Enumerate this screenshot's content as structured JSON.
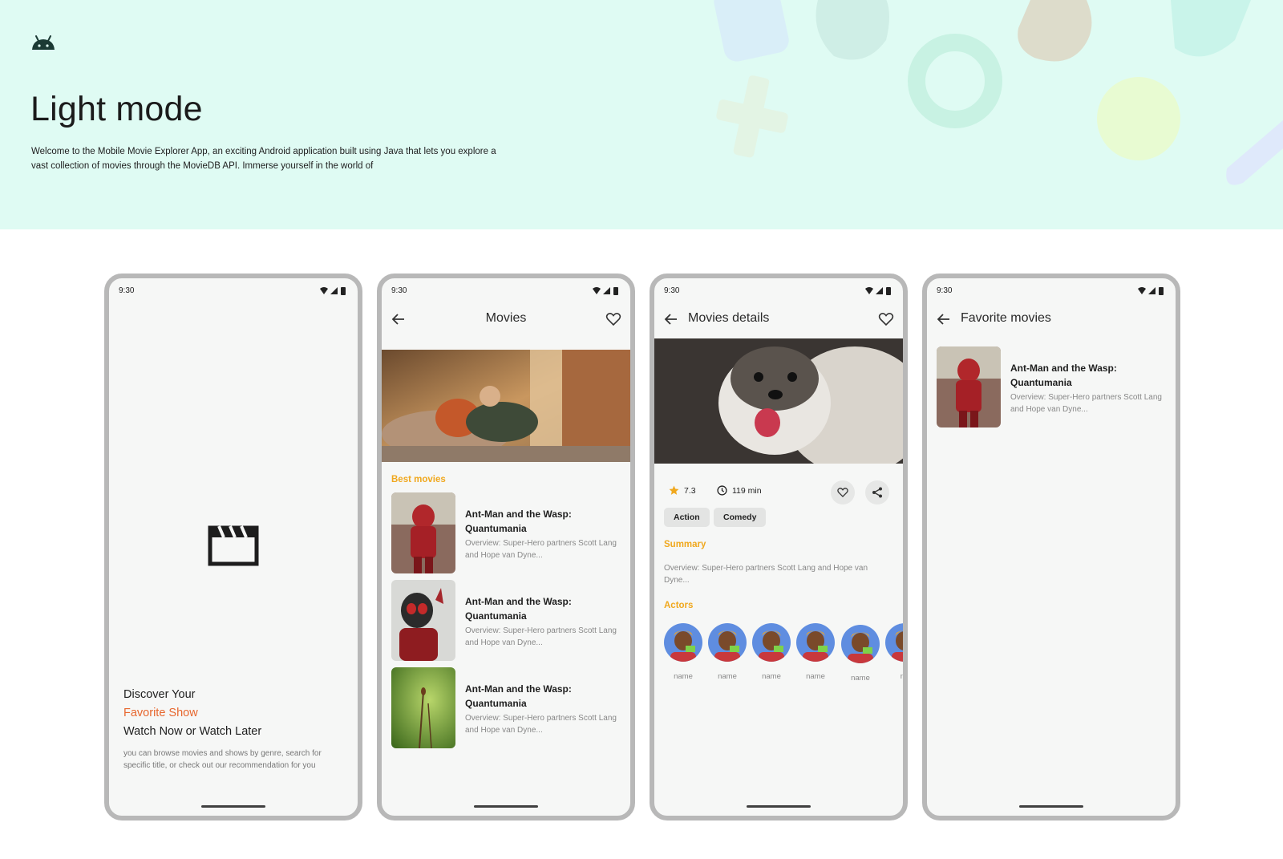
{
  "hero": {
    "title": "Light mode",
    "description": "Welcome to the Mobile Movie Explorer App, an exciting Android application built using Java that lets you explore a vast collection of movies through the MovieDB API. Immerse yourself in the world of"
  },
  "status": {
    "time": "9:30"
  },
  "splash": {
    "line1": "Discover Your",
    "line2": "Favorite Show",
    "line3": "Watch Now or Watch Later",
    "subtitle": "you can browse movies and shows by genre, search for specific title, or check out our recommendation for you"
  },
  "movies_screen": {
    "title": "Movies",
    "section": "Best movies",
    "items": [
      {
        "title": "Ant-Man and the Wasp: Quantumania",
        "overview": "Overview: Super-Hero partners Scott Lang and Hope van Dyne..."
      },
      {
        "title": "Ant-Man and the Wasp: Quantumania",
        "overview": "Overview: Super-Hero partners Scott Lang and Hope van Dyne..."
      },
      {
        "title": "Ant-Man and the Wasp: Quantumania",
        "overview": "Overview: Super-Hero partners Scott Lang and Hope van Dyne..."
      }
    ]
  },
  "details_screen": {
    "title": "Movies details",
    "rating": "7.3",
    "duration": "119 min",
    "genres": [
      "Action",
      "Comedy"
    ],
    "summary_label": "Summary",
    "summary": "Overview: Super-Hero partners Scott Lang and Hope van Dyne...",
    "actors_label": "Actors",
    "actors": [
      "name",
      "name",
      "name",
      "name",
      "name",
      "na"
    ]
  },
  "favorites_screen": {
    "title": "Favorite movies",
    "items": [
      {
        "title": "Ant-Man and the Wasp: Quantumania",
        "overview": "Overview: Super-Hero partners Scott Lang and Hope van Dyne..."
      }
    ]
  },
  "colors": {
    "accent_orange": "#e7662d",
    "accent_yellow": "#f0a81e",
    "hero_bg": "#dffbf3"
  },
  "icons": [
    "android-icon",
    "wifi-icon",
    "signal-icon",
    "battery-icon",
    "clapperboard-icon",
    "back-arrow-icon",
    "heart-icon",
    "star-icon",
    "clock-icon",
    "share-icon"
  ]
}
